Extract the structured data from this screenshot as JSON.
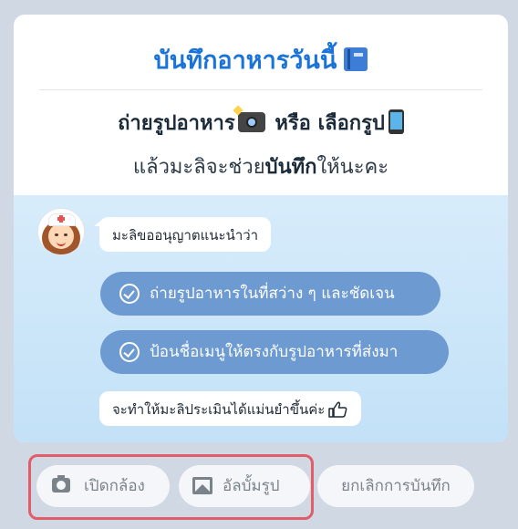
{
  "header": {
    "title": "บันทึกอาหารวันนี้",
    "title_icon": "blue-book-icon"
  },
  "intro": {
    "line1_a": "ถ่ายรูปอาหาร",
    "line1_b": "หรือ",
    "line1_c": "เลือกรูป",
    "line2_a": "แล้วมะลิจะช่วย",
    "line2_b": "บันทึก",
    "line2_c": "ให้นะคะ"
  },
  "chat": {
    "intro_message": "มะลิขออนุญาตแนะนำว่า",
    "tips": [
      "ถ่ายรูปอาหารในที่สว่าง ๆ และชัดเจน",
      "ป้อนชื่อเมนูให้ตรงกับรูปอาหารที่ส่งมา"
    ],
    "closing_message": "จะทำให้มะลิประเมินได้แม่นยำขึ้นค่ะ"
  },
  "actions": {
    "camera_label": "เปิดกล้อง",
    "album_label": "อัลบั้มรูป",
    "cancel_label": "ยกเลิกการบันทึก"
  },
  "colors": {
    "title": "#1a73d9",
    "tip_pill": "#6d9ad1",
    "highlight_outline": "#e25c6a",
    "chat_background": "#d7ecfb"
  }
}
